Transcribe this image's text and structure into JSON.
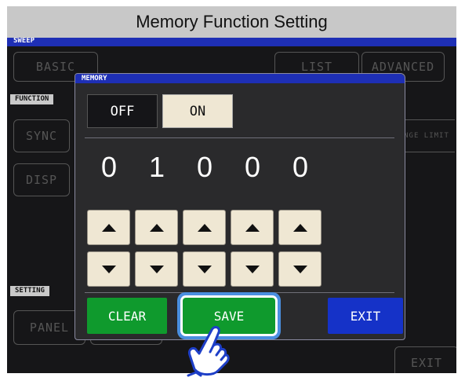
{
  "header": {
    "title": "Memory Function Setting"
  },
  "screen": {
    "sweep_label": "SWEEP",
    "tabs": [
      {
        "label": "BASIC"
      },
      {
        "label": "LIST"
      },
      {
        "label": "ADVANCED"
      }
    ],
    "function_label": "FUNCTION",
    "function_items": [
      {
        "label": "SYNC"
      },
      {
        "label": "DISP"
      }
    ],
    "range_limit_label": "NGE LIMIT",
    "setting_label": "SETTING",
    "panel_label": "PANEL",
    "exit_label": "EXIT"
  },
  "dialog": {
    "title": "MEMORY",
    "toggle": {
      "off_label": "OFF",
      "on_label": "ON",
      "selected": "OFF"
    },
    "digits": [
      "0",
      "1",
      "0",
      "0",
      "0"
    ],
    "buttons": {
      "clear": "CLEAR",
      "save": "SAVE",
      "exit": "EXIT"
    }
  },
  "colors": {
    "title_bar_blue": "#1e2fb5",
    "green": "#0f9a2d",
    "exit_blue": "#1532c8",
    "highlight": "#4a8fe0"
  },
  "icons": {
    "pointer": "pointing-hand-icon"
  }
}
